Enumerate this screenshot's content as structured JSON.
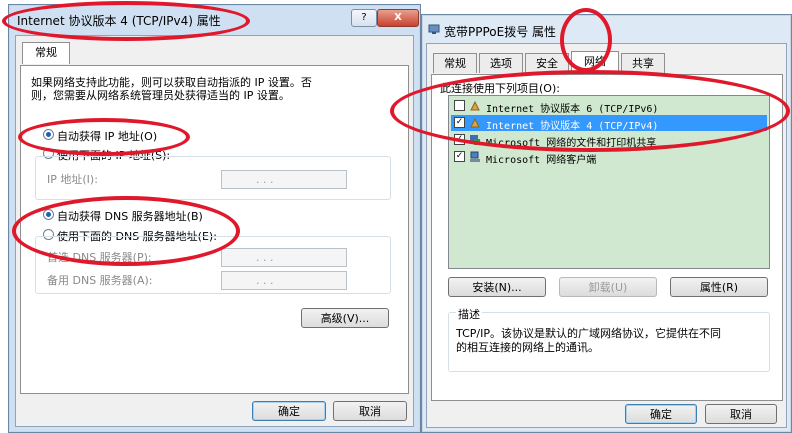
{
  "left_window": {
    "title": "Internet 协议版本 4 (TCP/IPv4) 属性",
    "help_label": "?",
    "close_label": "X",
    "tab": "常规",
    "description": [
      "如果网络支持此功能，则可以获取自动指派的 IP 设置。否",
      "则，您需要从网络系统管理员处获得适当的 IP 设置。"
    ],
    "auto_ip_label": "自动获得 IP 地址(O)",
    "manual_ip_label": "使用下面的 IP 地址(S):",
    "ip_address_label": "IP 地址(I):",
    "auto_dns_label": "自动获得 DNS 服务器地址(B)",
    "manual_dns_label": "使用下面的 DNS 服务器地址(E):",
    "preferred_dns_label": "首选 DNS 服务器(P):",
    "alternate_dns_label": "备用 DNS 服务器(A):",
    "ip_dots": ". . .",
    "advanced_label": "高级(V)...",
    "ok_label": "确定",
    "cancel_label": "取消"
  },
  "right_window": {
    "title": "宽带PPPoE拨号 属性",
    "tabs": [
      "常规",
      "选项",
      "安全",
      "网络",
      "共享"
    ],
    "active_tab": "网络",
    "list_label": "此连接使用下列项目(O):",
    "items": [
      {
        "label": "Internet 协议版本 6 (TCP/IPv6)",
        "checked": false,
        "icon": "network-protocol-icon"
      },
      {
        "label": "Internet 协议版本 4 (TCP/IPv4)",
        "checked": true,
        "icon": "network-protocol-icon",
        "selected": true
      },
      {
        "label": "Microsoft 网络的文件和打印机共享",
        "checked": true,
        "icon": "file-printer-share-icon"
      },
      {
        "label": "Microsoft 网络客户端",
        "checked": true,
        "icon": "network-client-icon"
      }
    ],
    "install_label": "安装(N)...",
    "uninstall_label": "卸载(U)",
    "properties_label": "属性(R)",
    "description_label": "描述",
    "description_text": [
      "TCP/IP。该协议是默认的广域网络协议，它提供在不同",
      "的相互连接的网络上的通讯。"
    ],
    "ok_label": "确定",
    "cancel_label": "取消"
  },
  "colors": {
    "annotation": "#e0182b",
    "selection": "#3399ff",
    "list_bg": "#cfe8cf"
  }
}
